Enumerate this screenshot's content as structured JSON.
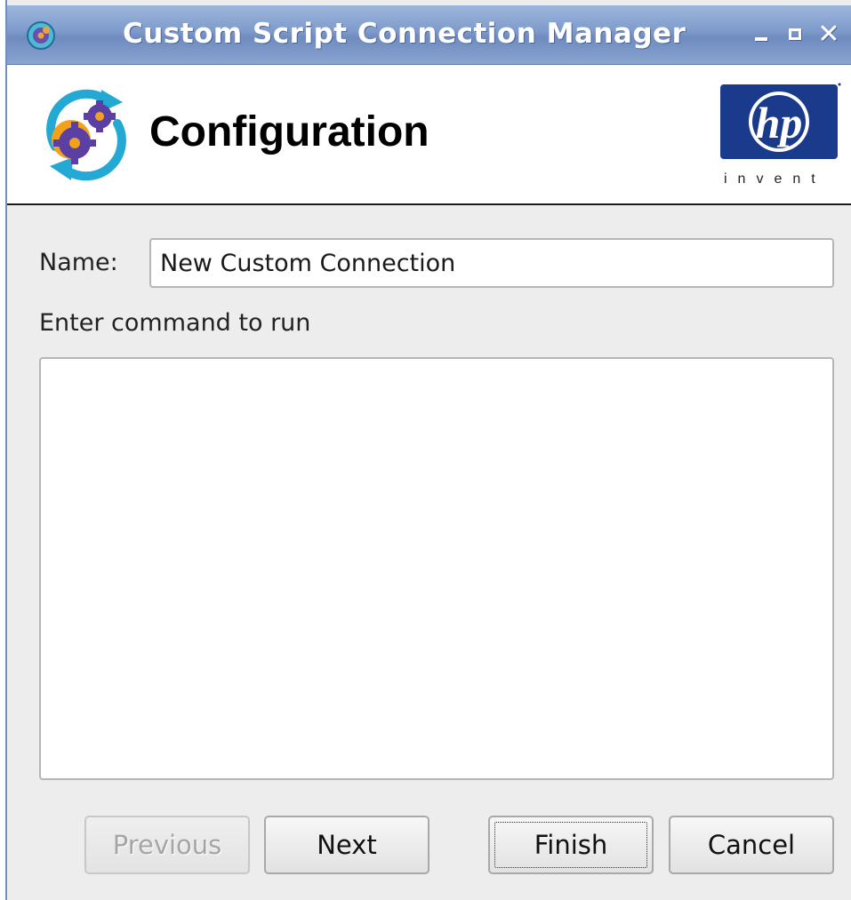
{
  "window": {
    "title": "Custom Script Connection Manager",
    "controls": {
      "minimize_icon": "minimize-icon",
      "maximize_icon": "maximize-icon",
      "close_icon": "close-icon",
      "close_glyph": "✕"
    }
  },
  "header": {
    "title": "Configuration",
    "icon": "gears-refresh-icon",
    "logo": {
      "text": "hp",
      "tagline": "invent",
      "brand_color": "#1a3a8c"
    }
  },
  "form": {
    "name_label": "Name:",
    "name_value": "New Custom Connection",
    "command_label": "Enter command to run",
    "command_value": ""
  },
  "buttons": {
    "previous": {
      "label": "Previous",
      "enabled": false
    },
    "next": {
      "label": "Next",
      "enabled": true
    },
    "finish": {
      "label": "Finish",
      "enabled": true,
      "focused": true
    },
    "cancel": {
      "label": "Cancel",
      "enabled": true
    }
  },
  "colors": {
    "titlebar": "#7e9acb",
    "window_bg": "#ededed"
  }
}
